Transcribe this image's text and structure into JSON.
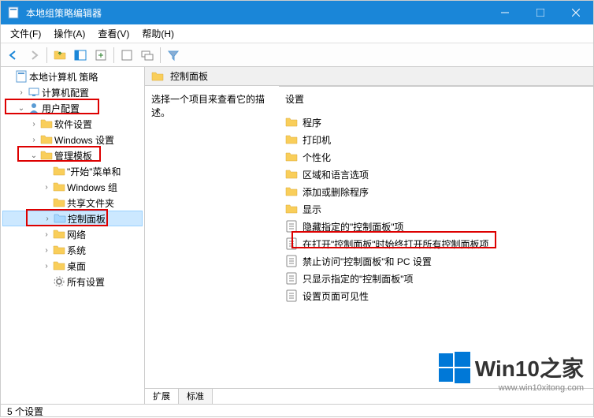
{
  "window": {
    "title": "本地组策略编辑器"
  },
  "menubar": {
    "file": "文件(F)",
    "action": "操作(A)",
    "view": "查看(V)",
    "help": "帮助(H)"
  },
  "tree": {
    "root": "本地计算机 策略",
    "computer_config": "计算机配置",
    "user_config": "用户配置",
    "software_settings": "软件设置",
    "windows_settings": "Windows 设置",
    "admin_templates": "管理模板",
    "start_menu": "\"开始\"菜单和",
    "windows_components": "Windows 组",
    "shared_folders": "共享文件夹",
    "control_panel": "控制面板",
    "network": "网络",
    "system": "系统",
    "desktop": "桌面",
    "all_settings": "所有设置"
  },
  "content": {
    "header": "控制面板",
    "description": "选择一个项目来查看它的描述。",
    "settings_label": "设置",
    "items": [
      {
        "type": "folder",
        "label": "程序"
      },
      {
        "type": "folder",
        "label": "打印机"
      },
      {
        "type": "folder",
        "label": "个性化"
      },
      {
        "type": "folder",
        "label": "区域和语言选项"
      },
      {
        "type": "folder",
        "label": "添加或删除程序"
      },
      {
        "type": "folder",
        "label": "显示"
      },
      {
        "type": "policy",
        "label": "隐藏指定的\"控制面板\"项"
      },
      {
        "type": "policy",
        "label": "在打开\"控制面板\"时始终打开所有控制面板项"
      },
      {
        "type": "policy",
        "label": "禁止访问\"控制面板\"和 PC 设置"
      },
      {
        "type": "policy",
        "label": "只显示指定的\"控制面板\"项"
      },
      {
        "type": "policy",
        "label": "设置页面可见性"
      }
    ]
  },
  "tabs": {
    "extended": "扩展",
    "standard": "标准"
  },
  "statusbar": {
    "text": "5 个设置"
  },
  "watermark": {
    "title": "Win10之家",
    "url": "www.win10xitong.com"
  }
}
